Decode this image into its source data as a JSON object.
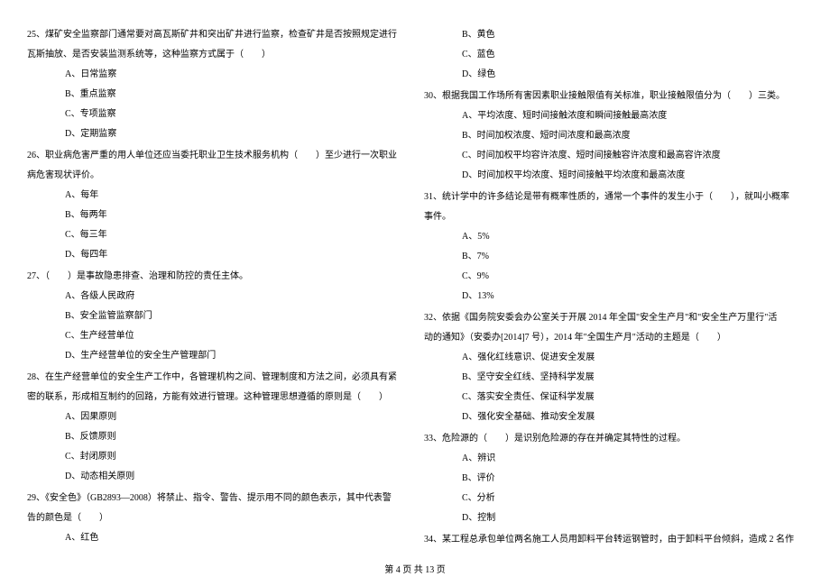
{
  "left": {
    "q25": {
      "text1": "25、煤矿安全监察部门通常要对高瓦斯矿井和突出矿井进行监察，检查矿井是否按照规定进行",
      "text2": "瓦斯抽放、是否安装监测系统等，这种监察方式属于（　　）",
      "optA": "A、日常监察",
      "optB": "B、重点监察",
      "optC": "C、专项监察",
      "optD": "D、定期监察"
    },
    "q26": {
      "text1": "26、职业病危害严重的用人单位还应当委托职业卫生技术服务机构（　　）至少进行一次职业",
      "text2": "病危害现状评价。",
      "optA": "A、每年",
      "optB": "B、每两年",
      "optC": "C、每三年",
      "optD": "D、每四年"
    },
    "q27": {
      "text": "27、（　　）是事故隐患排查、治理和防控的责任主体。",
      "optA": "A、各级人民政府",
      "optB": "B、安全监管监察部门",
      "optC": "C、生产经营单位",
      "optD": "D、生产经营单位的安全生产管理部门"
    },
    "q28": {
      "text1": "28、在生产经营单位的安全生产工作中，各管理机构之间、管理制度和方法之间，必须具有紧",
      "text2": "密的联系，形成相互制约的回路，方能有效进行管理。这种管理思想遵循的原则是（　　）",
      "optA": "A、因果原则",
      "optB": "B、反馈原则",
      "optC": "C、封闭原则",
      "optD": "D、动态相关原则"
    },
    "q29": {
      "text1": "29、《安全色》（GB2893—2008）将禁止、指令、警告、提示用不同的颜色表示，其中代表警",
      "text2": "告的颜色是（　　）",
      "optA": "A、红色"
    }
  },
  "right": {
    "q29cont": {
      "optB": "B、黄色",
      "optC": "C、蓝色",
      "optD": "D、绿色"
    },
    "q30": {
      "text": "30、根据我国工作场所有害因素职业接触限值有关标准，职业接触限值分为（　　）三类。",
      "optA": "A、平均浓度、短时间接触浓度和瞬间接触最高浓度",
      "optB": "B、时间加权浓度、短时间浓度和最高浓度",
      "optC": "C、时间加权平均容许浓度、短时间接触容许浓度和最高容许浓度",
      "optD": "D、时间加权平均浓度、短时间接触平均浓度和最高浓度"
    },
    "q31": {
      "text1": "31、统计学中的许多结论是带有概率性质的，通常一个事件的发生小于（　　），就叫小概率",
      "text2": "事件。",
      "optA": "A、5%",
      "optB": "B、7%",
      "optC": "C、9%",
      "optD": "D、13%"
    },
    "q32": {
      "text1": "32、依据《国务院安委会办公室关于开展 2014 年全国\"安全生产月\"和\"安全生产万里行\"活",
      "text2": "动的通知》（安委办[2014]7 号），2014 年\"全国生产月\"活动的主题是（　　）",
      "optA": "A、强化红线意识、促进安全发展",
      "optB": "B、坚守安全红线、坚持科学发展",
      "optC": "C、落实安全责任、保证科学发展",
      "optD": "D、强化安全基础、推动安全发展"
    },
    "q33": {
      "text": "33、危险源的（　　）是识别危险源的存在并确定其特性的过程。",
      "optA": "A、辨识",
      "optB": "B、评价",
      "optC": "C、分析",
      "optD": "D、控制"
    },
    "q34": {
      "text": "34、某工程总承包单位两名施工人员用卸料平台转运钢管时，由于卸料平台倾斜，造成 2 名作"
    }
  },
  "footer": "第 4 页 共 13 页"
}
